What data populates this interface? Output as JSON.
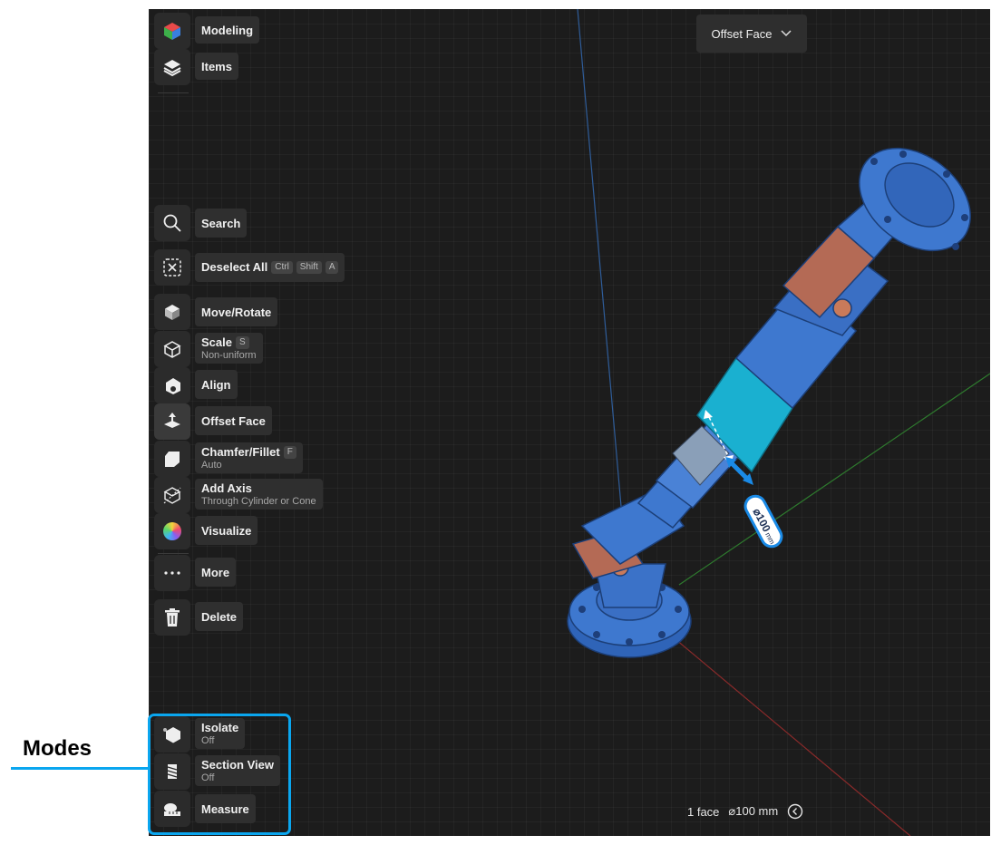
{
  "toolbar_top": [
    {
      "label": "Modeling",
      "icon": "modeling-cube-icon"
    },
    {
      "label": "Items",
      "icon": "layers-icon"
    }
  ],
  "tools": {
    "search": {
      "label": "Search",
      "icon": "search-icon"
    },
    "deselect": {
      "label": "Deselect All",
      "keys": [
        "Ctrl",
        "Shift",
        "A"
      ],
      "icon": "deselect-icon"
    },
    "move": {
      "label": "Move/Rotate",
      "icon": "move-rotate-icon"
    },
    "scale": {
      "label": "Scale",
      "key": "S",
      "sub": "Non-uniform",
      "icon": "scale-icon"
    },
    "align": {
      "label": "Align",
      "icon": "align-icon"
    },
    "offset": {
      "label": "Offset Face",
      "icon": "offset-face-icon"
    },
    "chamfer": {
      "label": "Chamfer/Fillet",
      "key": "F",
      "sub": "Auto",
      "icon": "chamfer-fillet-icon"
    },
    "axis": {
      "label": "Add Axis",
      "sub": "Through Cylinder or Cone",
      "icon": "add-axis-icon"
    },
    "visualize": {
      "label": "Visualize",
      "icon": "visualize-icon"
    },
    "more": {
      "label": "More",
      "icon": "more-icon"
    },
    "delete": {
      "label": "Delete",
      "icon": "trash-icon"
    }
  },
  "modes": {
    "isolate": {
      "label": "Isolate",
      "sub": "Off",
      "icon": "isolate-icon"
    },
    "section": {
      "label": "Section View",
      "sub": "Off",
      "icon": "section-view-icon"
    },
    "measure": {
      "label": "Measure",
      "icon": "measure-icon"
    }
  },
  "dropdown": {
    "label": "Offset Face"
  },
  "dimension": {
    "text": "⌀100",
    "unit": "mm"
  },
  "status": {
    "count": "1 face",
    "diameter": "⌀100 mm"
  },
  "annotation": {
    "title": "Modes"
  },
  "colors": {
    "accent": "#0aa6ef",
    "part": "#3e78cf",
    "selected_face": "#1ab0d0"
  }
}
